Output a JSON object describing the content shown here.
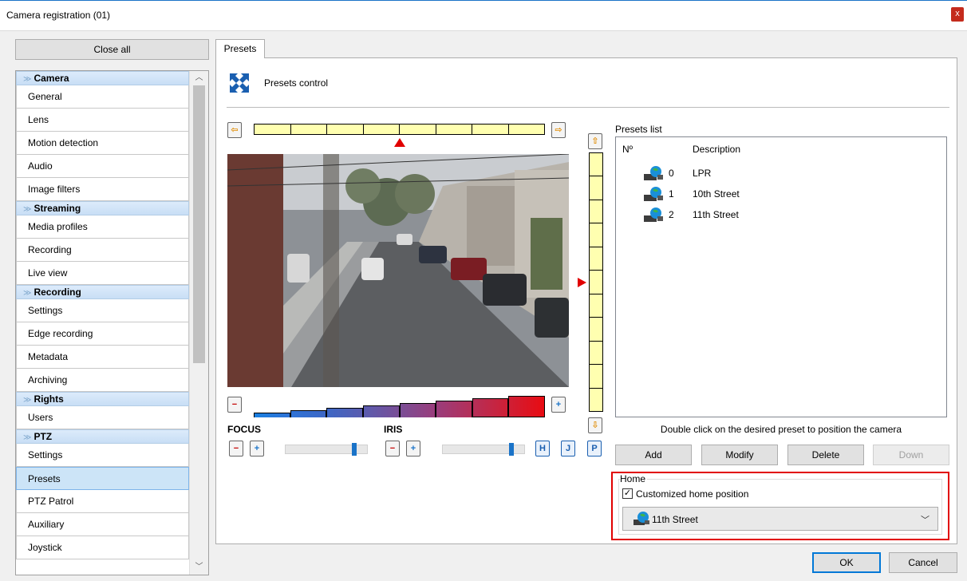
{
  "window": {
    "title": "Camera registration (01)",
    "close_glyph": "x"
  },
  "nav": {
    "close_all": "Close all",
    "sections": [
      {
        "title": "Camera",
        "items": [
          "General",
          "Lens",
          "Motion detection",
          "Audio",
          "Image filters"
        ]
      },
      {
        "title": "Streaming",
        "items": [
          "Media profiles",
          "Recording",
          "Live view"
        ]
      },
      {
        "title": "Recording",
        "items": [
          "Settings",
          "Edge recording",
          "Metadata",
          "Archiving"
        ]
      },
      {
        "title": "Rights",
        "items": [
          "Users"
        ]
      },
      {
        "title": "PTZ",
        "items": [
          "Settings",
          "Presets",
          "PTZ Patrol",
          "Auxiliary",
          "Joystick"
        ]
      }
    ],
    "selected": "Presets"
  },
  "tab": {
    "label": "Presets"
  },
  "presets_control": {
    "title": "Presets control",
    "focus_label": "FOCUS",
    "iris_label": "IRIS",
    "focus_level": 0.85,
    "iris_level": 0.85,
    "pan_position": 0.5,
    "tilt_position": 0.5,
    "zoom_level": 0.75,
    "buttons": {
      "minus": "−",
      "plus": "+",
      "left": "⇦",
      "right": "⇨",
      "up": "⇧",
      "down": "⇩",
      "h": "H",
      "j": "J",
      "p": "P"
    }
  },
  "presets_list": {
    "label": "Presets list",
    "columns": [
      "Nº",
      "Description"
    ],
    "rows": [
      {
        "num": "0",
        "desc": "LPR"
      },
      {
        "num": "1",
        "desc": "10th Street"
      },
      {
        "num": "2",
        "desc": "11th Street"
      }
    ],
    "hint": "Double click on the desired preset to position the camera",
    "actions": {
      "add": "Add",
      "modify": "Modify",
      "delete": "Delete",
      "down": "Down"
    }
  },
  "home": {
    "legend": "Home",
    "checkbox_label": "Customized home position",
    "checked": true,
    "selected": "11th Street"
  },
  "footer": {
    "ok": "OK",
    "cancel": "Cancel"
  },
  "colors": {
    "accent": "#1a73c8",
    "highlight": "#e10000",
    "bar_fill": "#ffffb0",
    "selection": "#cce4f7"
  }
}
